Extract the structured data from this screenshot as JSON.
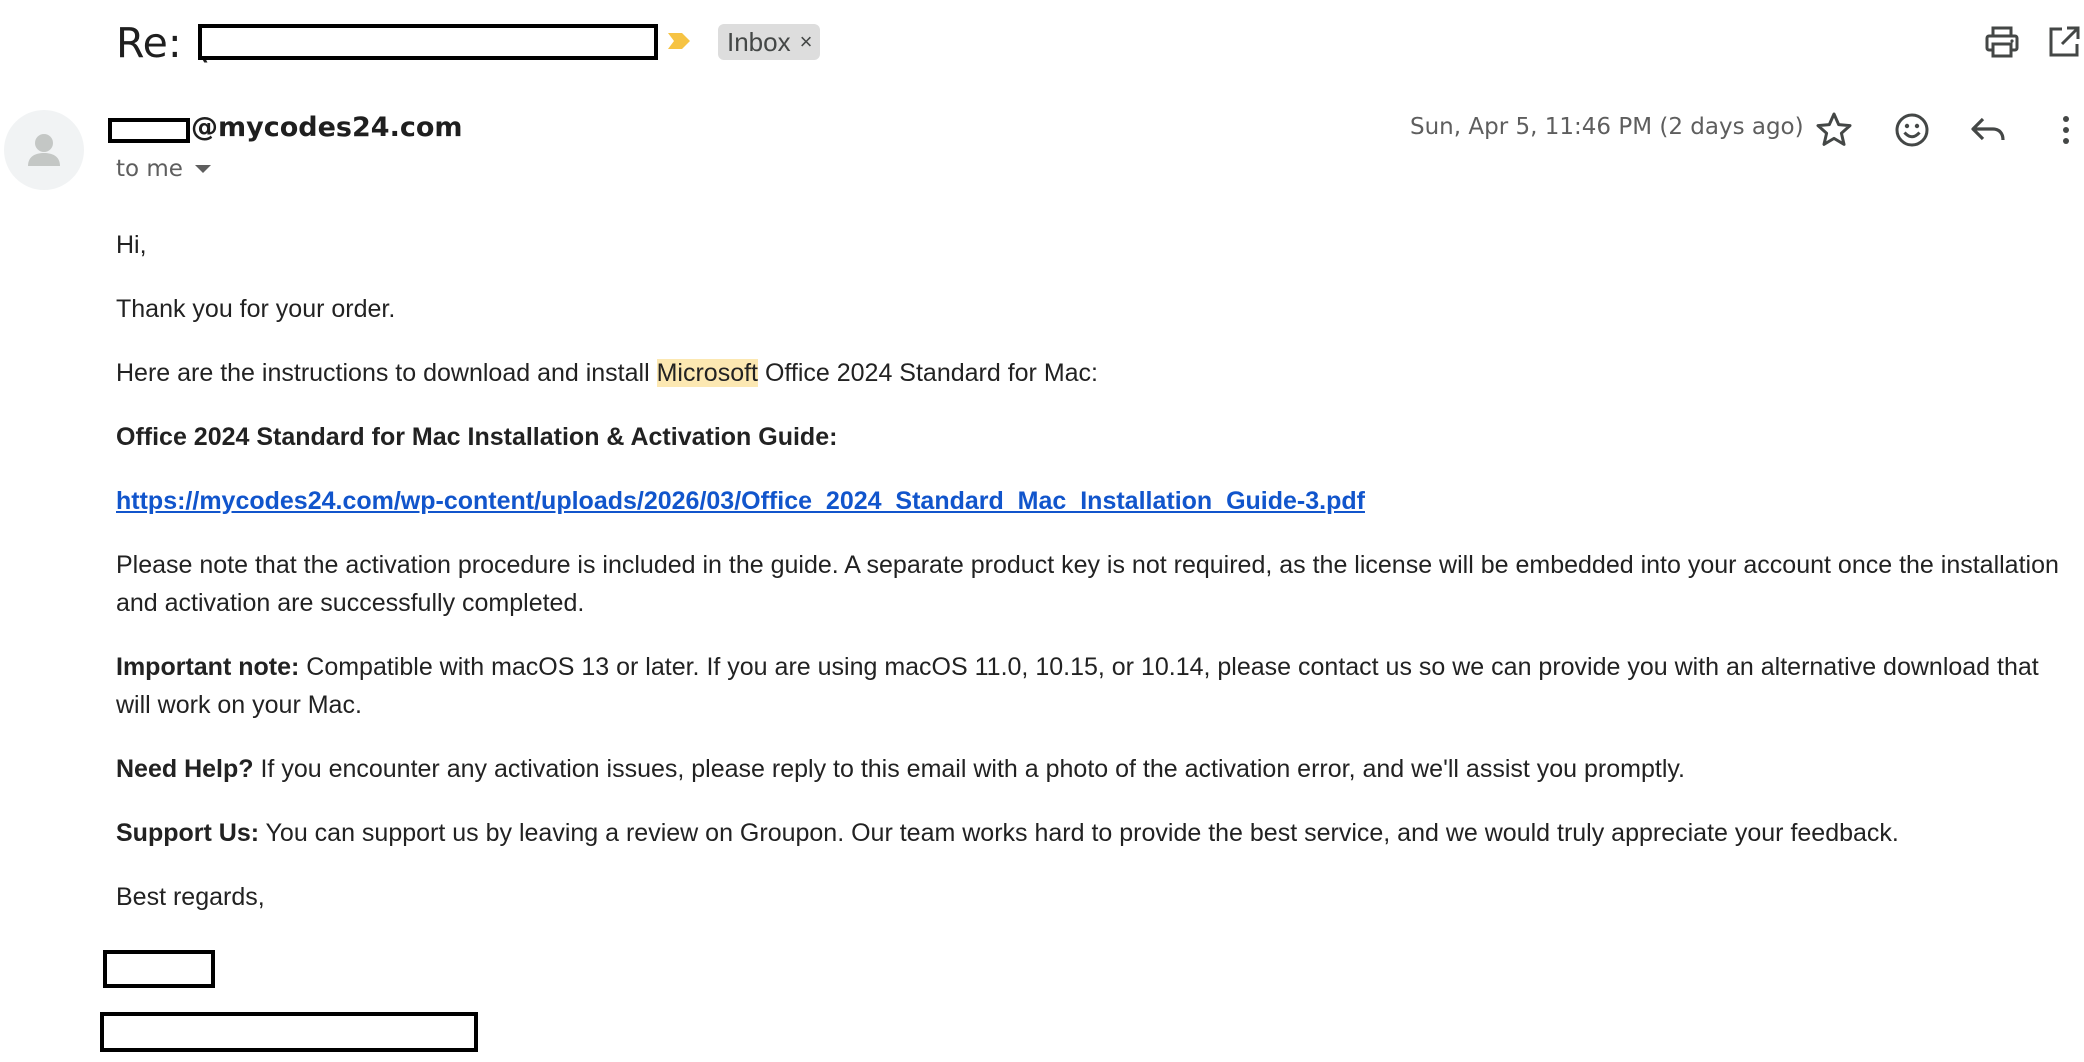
{
  "subject": {
    "prefix": "Re: (",
    "label": "Inbox",
    "label_close": "×"
  },
  "toolbar": {
    "print_icon": "printer-icon",
    "open_new_window_icon": "open-in-new-icon"
  },
  "sender": {
    "domain": "@mycodes24.com",
    "recipient": "to me"
  },
  "message_meta": {
    "timestamp": "Sun, Apr 5, 11:46 PM (2 days ago)"
  },
  "body": {
    "greeting": "Hi,",
    "thanks": "Thank you for your order.",
    "instructions_pre": "Here are the instructions to download and install ",
    "instructions_highlight": "Microsoft",
    "instructions_post": " Office 2024 Standard for Mac:",
    "guide_heading": "Office 2024 Standard for Mac Installation & Activation Guide:",
    "guide_link": "https://mycodes24.com/wp-content/uploads/2026/03/Office_2024_Standard_Mac_Installation_Guide-3.pdf",
    "activation_note": "Please note that the activation procedure is included in the guide. A separate product key is not required, as the license will be embedded into your account once the installation and activation are successfully completed.",
    "important_label": "Important note:",
    "important_text": " Compatible with macOS 13 or later. If you are using macOS 11.0, 10.15, or 10.14, please contact us so we can provide you with an alternative download that will work on your Mac.",
    "help_label": "Need Help?",
    "help_text": " If you encounter any activation issues, please reply to this email with a photo of the activation error, and we'll assist you promptly.",
    "support_label": "Support Us:",
    "support_text": " You can support us by leaving a review on Groupon. Our team works hard to provide the best service, and we would truly appreciate your feedback.",
    "closing": "Best regards,"
  },
  "colors": {
    "highlight": "#fce8b2",
    "link": "#1155cc",
    "importance_marker": "#f6c343",
    "label_chip_bg": "#dddddd"
  }
}
